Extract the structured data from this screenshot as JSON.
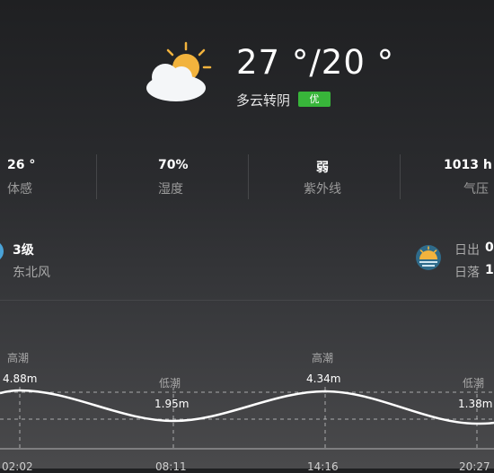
{
  "header": {
    "temp_range": "27 °/20 °",
    "condition": "多云转阴",
    "aqi_badge": "优"
  },
  "stats": [
    {
      "value": "26 °",
      "label": "体感"
    },
    {
      "value": "70%",
      "label": "湿度"
    },
    {
      "value": "弱",
      "label": "紫外线"
    },
    {
      "value": "1013 h",
      "label": "气压"
    }
  ],
  "wind": {
    "level": "3级",
    "direction": "东北风"
  },
  "sun": {
    "sunrise_label": "日出",
    "sunrise_value": "0",
    "sunset_label": "日落",
    "sunset_value": "1"
  },
  "tide": {
    "points": [
      {
        "type": "高潮",
        "height": "4.88m",
        "time": "02:02"
      },
      {
        "type": "低潮",
        "height": "1.95m",
        "time": "08:11"
      },
      {
        "type": "高潮",
        "height": "4.34m",
        "time": "14:16"
      },
      {
        "type": "低潮",
        "height": "1.38m",
        "time": "20:27"
      }
    ]
  },
  "colors": {
    "aqi_good": "#38b53a",
    "sun_icon": "#f2b33d",
    "cloud": "#f4f6f8"
  }
}
